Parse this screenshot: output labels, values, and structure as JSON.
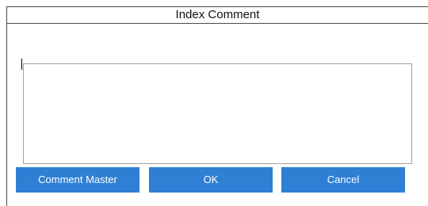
{
  "dialog": {
    "title": "Index Comment"
  },
  "comment_field": {
    "value": ""
  },
  "buttons": {
    "comment_master": "Comment Master",
    "ok": "OK",
    "cancel": "Cancel"
  },
  "colors": {
    "button_background": "#2f7fd4",
    "button_text": "#ffffff",
    "border": "#4a4a4a"
  }
}
